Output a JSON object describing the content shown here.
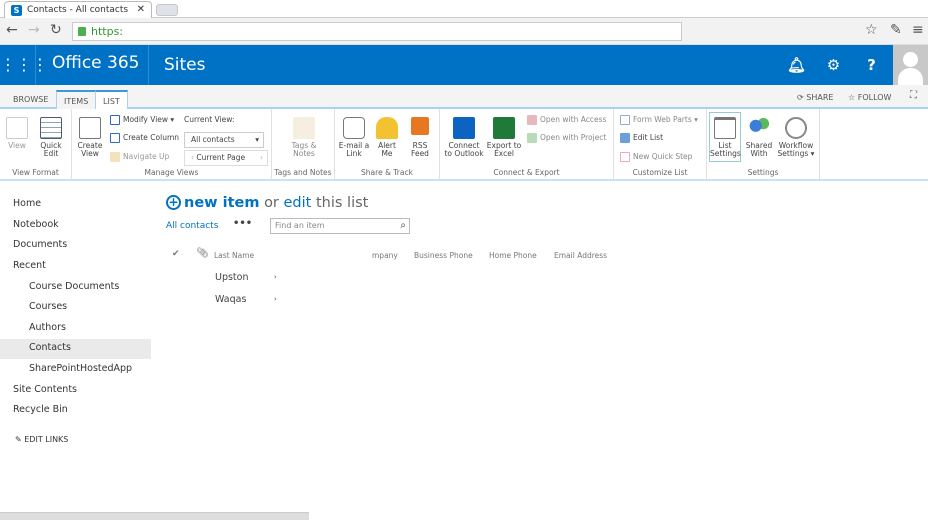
{
  "browser": {
    "tab_title": "Contacts - All contacts",
    "url": "https:",
    "favicon": "S"
  },
  "suite_bar": {
    "brand": "Office 365",
    "app": "Sites",
    "brand_color": "#0072c6"
  },
  "ribbon_tabs": [
    "BROWSE",
    "ITEMS",
    "LIST"
  ],
  "ribbon_actions": {
    "share": "SHARE",
    "follow": "FOLLOW"
  },
  "ribbon": {
    "view_format": {
      "label": "View Format",
      "view": "View",
      "quick_edit": "Quick Edit"
    },
    "manage_views": {
      "label": "Manage Views",
      "create_view": "Create View",
      "modify_view": "Modify View",
      "create_column": "Create Column",
      "navigate_up": "Navigate Up",
      "current_view_label": "Current View:",
      "current_view_value": "All contacts",
      "current_page": "Current Page"
    },
    "tags_notes": {
      "label": "Tags and Notes",
      "tags": "Tags & Notes"
    },
    "share_track": {
      "label": "Share & Track",
      "email": "E-mail a Link",
      "alert": "Alert Me",
      "rss": "RSS Feed"
    },
    "connect_export": {
      "label": "Connect & Export",
      "outlook": "Connect to Outlook",
      "excel": "Export to Excel",
      "access": "Open with Access",
      "project": "Open with Project"
    },
    "customize_list": {
      "label": "Customize List",
      "form_web_parts": "Form Web Parts",
      "edit_list": "Edit List",
      "quick_step": "New Quick Step"
    },
    "settings": {
      "label": "Settings",
      "list_settings": "List Settings",
      "shared_with": "Shared With",
      "workflow": "Workflow Settings"
    }
  },
  "left_nav": {
    "items": [
      "Home",
      "Notebook",
      "Documents",
      "Recent",
      "Course Documents",
      "Courses",
      "Authors",
      "Contacts",
      "SharePointHostedApp",
      "Site Contents",
      "Recycle Bin"
    ],
    "edit_links": "EDIT LINKS",
    "selected": "Contacts"
  },
  "main": {
    "new_item": "new item",
    "or": "or",
    "edit": "edit",
    "this_list": "this list",
    "view": "All contacts",
    "more": "•••",
    "search_placeholder": "Find an item",
    "columns": [
      "Last Name",
      "mpany",
      "Business Phone",
      "Home Phone",
      "Email Address"
    ],
    "rows": [
      {
        "last_name": "Upston"
      },
      {
        "last_name": "Waqas"
      }
    ]
  }
}
